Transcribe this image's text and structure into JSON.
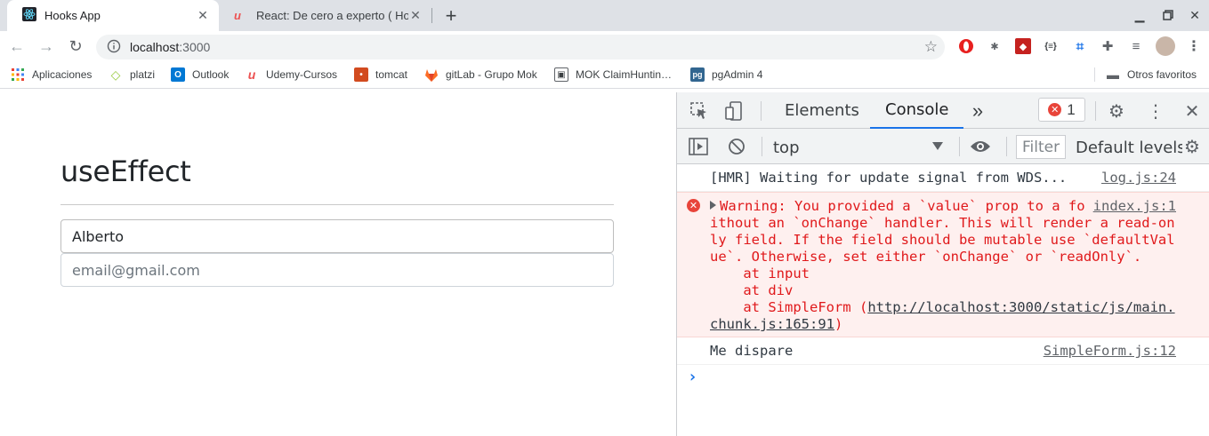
{
  "browser": {
    "tabs": [
      {
        "title": "Hooks App",
        "active": true
      },
      {
        "title": "React: De cero a experto ( Hooks",
        "active": false
      }
    ],
    "address": {
      "host": "localhost",
      "port": ":3000"
    },
    "bookmarks": [
      {
        "label": "Aplicaciones",
        "icon": "apps-grid-icon"
      },
      {
        "label": "platzi",
        "icon": "platzi-icon"
      },
      {
        "label": "Outlook",
        "icon": "outlook-icon"
      },
      {
        "label": "Udemy-Cursos",
        "icon": "udemy-icon"
      },
      {
        "label": "tomcat",
        "icon": "tomcat-icon"
      },
      {
        "label": "gitLab - Grupo Mok",
        "icon": "gitlab-icon"
      },
      {
        "label": "MOK ClaimHuntin…",
        "icon": "mok-icon"
      },
      {
        "label": "pgAdmin 4",
        "icon": "pgadmin-icon"
      },
      {
        "label": "Otros favoritos",
        "icon": "folder-icon"
      }
    ]
  },
  "page": {
    "heading": "useEffect",
    "name_value": "Alberto",
    "email_placeholder": "email@gmail.com"
  },
  "devtools": {
    "tabs": {
      "elements": "Elements",
      "console": "Console"
    },
    "error_count": "1",
    "context": "top",
    "filter_placeholder": "Filter",
    "levels": "Default levels",
    "messages": {
      "hmr": {
        "text": "[HMR] Waiting for update signal from WDS...",
        "source": "log.js:24"
      },
      "warning": {
        "text": "Warning: You provided a `value` prop to a form field without an `onChange` handler. This will render a read-only field. If the field should be mutable use `defaultValue`. Otherwise, set either `onChange` or `readOnly`.",
        "stack1": "    at input",
        "stack2": "    at div",
        "stack3_prefix": "    at SimpleForm (",
        "stack3_link": "http://localhost:3000/static/js/main.chunk.js:165:91",
        "stack3_suffix": ")",
        "source": "index.js:1"
      },
      "log": {
        "text": "Me dispare",
        "source": "SimpleForm.js:12"
      }
    }
  },
  "colors": {
    "accent": "#1a73e8",
    "error": "#e0191b",
    "error_bg": "#fef0ef"
  }
}
